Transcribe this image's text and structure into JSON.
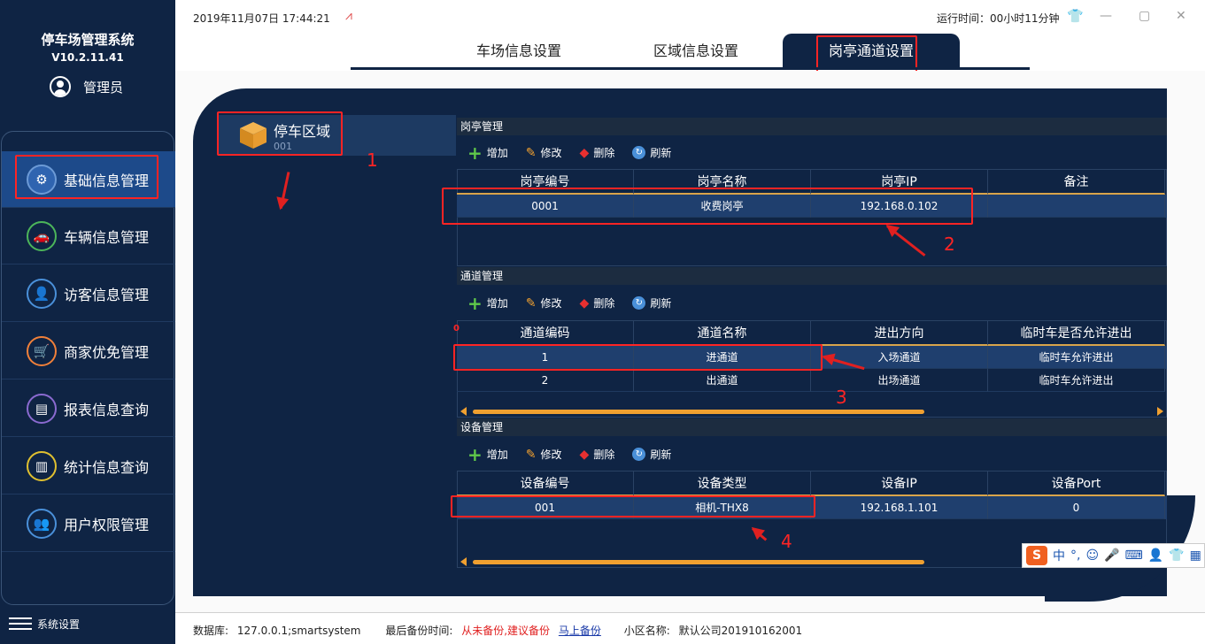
{
  "app": {
    "title": "停车场管理系统",
    "version": "V10.2.11.41",
    "user": "管理员"
  },
  "menu": [
    {
      "label": "基础信息管理",
      "icon": "gear-icon"
    },
    {
      "label": "车辆信息管理",
      "icon": "car-icon"
    },
    {
      "label": "访客信息管理",
      "icon": "visitor-icon"
    },
    {
      "label": "商家优免管理",
      "icon": "cart-icon"
    },
    {
      "label": "报表信息查询",
      "icon": "report-icon"
    },
    {
      "label": "统计信息查询",
      "icon": "stats-icon"
    },
    {
      "label": "用户权限管理",
      "icon": "users-icon"
    }
  ],
  "system_settings": "系统设置",
  "header": {
    "datetime": "2019年11月07日 17:44:21",
    "runtime": "运行时间：00小时11分钟"
  },
  "tabs": [
    "车场信息设置",
    "区域信息设置",
    "岗亭通道设置"
  ],
  "area": {
    "name": "停车区域",
    "code": "001"
  },
  "toolbar": {
    "add": "增加",
    "edit": "修改",
    "delete": "删除",
    "refresh": "刷新"
  },
  "booth": {
    "title": "岗亭管理",
    "columns": [
      "岗亭编号",
      "岗亭名称",
      "岗亭IP",
      "备注"
    ],
    "rows": [
      [
        "0001",
        "收费岗亭",
        "192.168.0.102",
        ""
      ]
    ]
  },
  "channel": {
    "title": "通道管理",
    "columns": [
      "通道编码",
      "通道名称",
      "进出方向",
      "临时车是否允许进出"
    ],
    "rows": [
      [
        "1",
        "进通道",
        "入场通道",
        "临时车允许进出"
      ],
      [
        "2",
        "出通道",
        "出场通道",
        "临时车允许进出"
      ]
    ],
    "marker": "0"
  },
  "device": {
    "title": "设备管理",
    "columns": [
      "设备编号",
      "设备类型",
      "设备IP",
      "设备Port"
    ],
    "rows": [
      [
        "001",
        "相机-THX8",
        "192.168.1.101",
        "0"
      ]
    ]
  },
  "annotations": [
    "1",
    "2",
    "3",
    "4"
  ],
  "status": {
    "db_label": "数据库:",
    "db_value": "127.0.0.1;smartsystem",
    "backup_label": "最后备份时间:",
    "backup_warn": "从未备份,建议备份",
    "backup_link": "马上备份",
    "community_label": "小区名称:",
    "community_value": "默认公司201910162001"
  },
  "ime": {
    "label": "中"
  },
  "colors": {
    "sidebar": "#0f2444",
    "accent": "#f0a030",
    "highlight": "#ff2424"
  }
}
